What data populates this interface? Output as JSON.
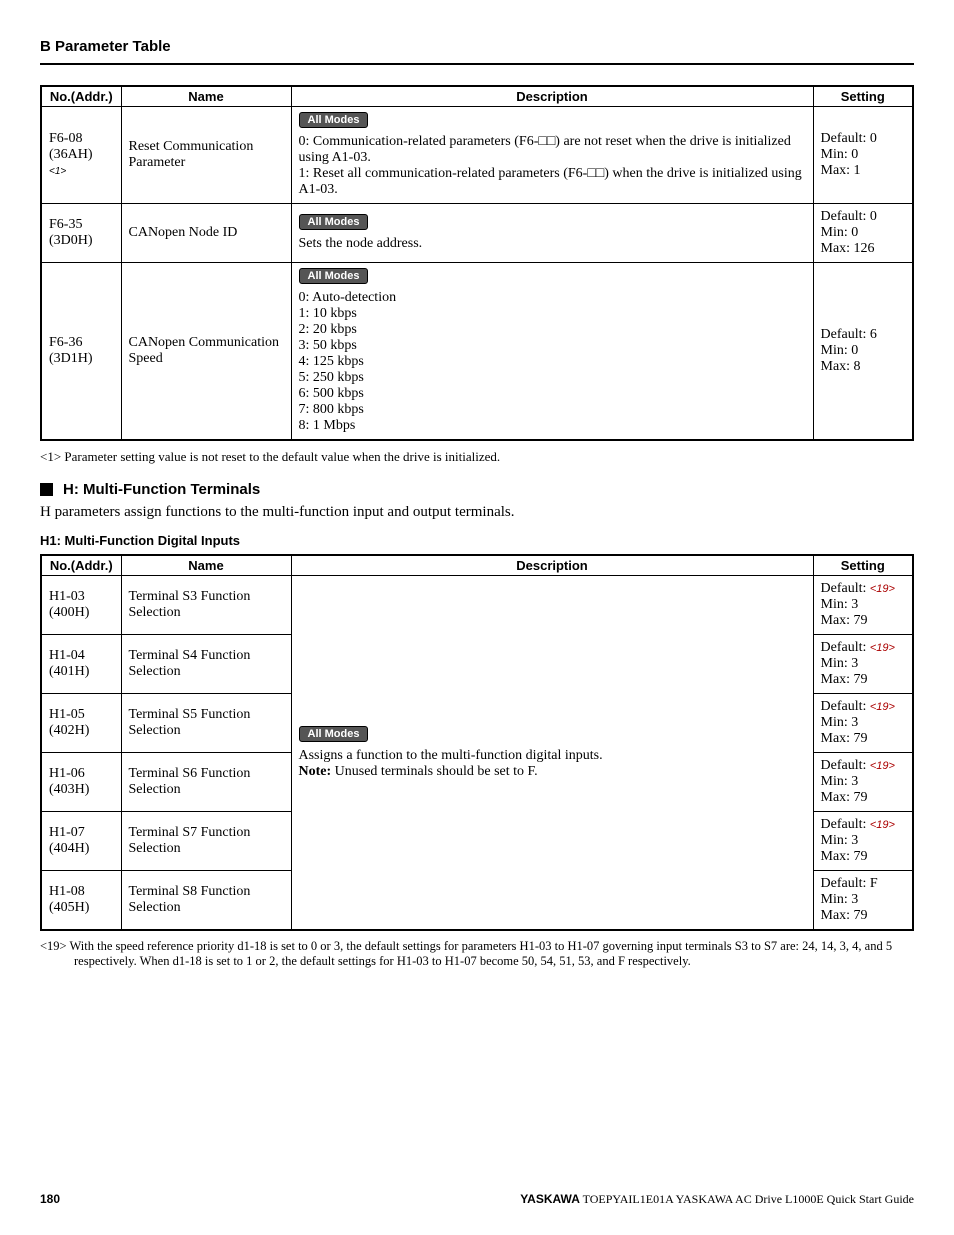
{
  "header": "B  Parameter Table",
  "table1": {
    "headers": [
      "No.(Addr.)",
      "Name",
      "Description",
      "Setting"
    ],
    "rows": [
      {
        "no_line1": "F6-08",
        "no_line2": "(36AH)",
        "no_sub": "<1>",
        "name": "Reset Communication Parameter",
        "badge": "All Modes",
        "desc_lines": [
          "0: Communication-related parameters (F6-□□) are not reset when the drive is initialized using A1-03.",
          "1: Reset all communication-related parameters (F6-□□) when the drive is initialized using",
          "A1-03."
        ],
        "set_default": "Default: 0",
        "set_min": "Min: 0",
        "set_max": "Max: 1"
      },
      {
        "no_line1": "F6-35",
        "no_line2": "(3D0H)",
        "name": "CANopen Node ID",
        "badge": "All Modes",
        "desc_lines": [
          "Sets the node address."
        ],
        "set_default": "Default: 0",
        "set_min": "Min: 0",
        "set_max": "Max: 126"
      },
      {
        "no_line1": "F6-36",
        "no_line2": "(3D1H)",
        "name": "CANopen Communication Speed",
        "badge": "All Modes",
        "desc_lines": [
          "0: Auto-detection",
          "1: 10 kbps",
          "2: 20 kbps",
          "3: 50 kbps",
          "4: 125 kbps",
          "5: 250 kbps",
          "6: 500 kbps",
          "7: 800 kbps",
          "8: 1 Mbps"
        ],
        "set_default": "Default: 6",
        "set_min": "Min: 0",
        "set_max": "Max: 8"
      }
    ]
  },
  "footnote1": "<1> Parameter setting value is not reset to the default value when the drive is initialized.",
  "section_h": "H: Multi-Function Terminals",
  "section_desc": "H parameters assign functions to the multi-function input and output terminals.",
  "subsection_h": "H1: Multi-Function Digital Inputs",
  "table2": {
    "headers": [
      "No.(Addr.)",
      "Name",
      "Description",
      "Setting"
    ],
    "shared_badge": "All Modes",
    "shared_desc_line1": "Assigns a function to the multi-function digital inputs.",
    "shared_desc_note_label": "Note:",
    "shared_desc_note_text": " Unused terminals should be set to F.",
    "rows": [
      {
        "no_line1": "H1-03",
        "no_line2": "(400H)",
        "name": "Terminal S3 Function Selection",
        "set_default_pre": "Default: ",
        "set_default_ref": "<19>",
        "set_min": "Min: 3",
        "set_max": "Max: 79"
      },
      {
        "no_line1": "H1-04",
        "no_line2": "(401H)",
        "name": "Terminal S4 Function Selection",
        "set_default_pre": "Default: ",
        "set_default_ref": "<19>",
        "set_min": "Min: 3",
        "set_max": "Max: 79"
      },
      {
        "no_line1": "H1-05",
        "no_line2": "(402H)",
        "name": "Terminal S5 Function Selection",
        "set_default_pre": "Default: ",
        "set_default_ref": "<19>",
        "set_min": "Min: 3",
        "set_max": "Max: 79"
      },
      {
        "no_line1": "H1-06",
        "no_line2": "(403H)",
        "name": "Terminal S6 Function Selection",
        "set_default_pre": "Default: ",
        "set_default_ref": "<19>",
        "set_min": "Min: 3",
        "set_max": "Max: 79"
      },
      {
        "no_line1": "H1-07",
        "no_line2": "(404H)",
        "name": "Terminal S7 Function Selection",
        "set_default_pre": "Default: ",
        "set_default_ref": "<19>",
        "set_min": "Min: 3",
        "set_max": "Max: 79"
      },
      {
        "no_line1": "H1-08",
        "no_line2": "(405H)",
        "name": "Terminal S8 Function Selection",
        "set_default_pre": "Default: F",
        "set_default_ref": "",
        "set_min": "Min: 3",
        "set_max": "Max: 79"
      }
    ]
  },
  "footnote19": "<19> With the speed reference priority d1-18 is set to 0 or 3, the default settings for parameters H1-03 to H1-07 governing input terminals S3 to S7 are: 24, 14, 3, 4, and 5 respectively. When d1-18 is set to 1 or 2, the default settings for H1-03 to H1-07 become 50, 54, 51, 53, and F respectively.",
  "footer": {
    "page": "180",
    "brand": "YASKAWA",
    "doc": " TOEPYAIL1E01A YASKAWA AC Drive L1000E Quick Start Guide"
  }
}
